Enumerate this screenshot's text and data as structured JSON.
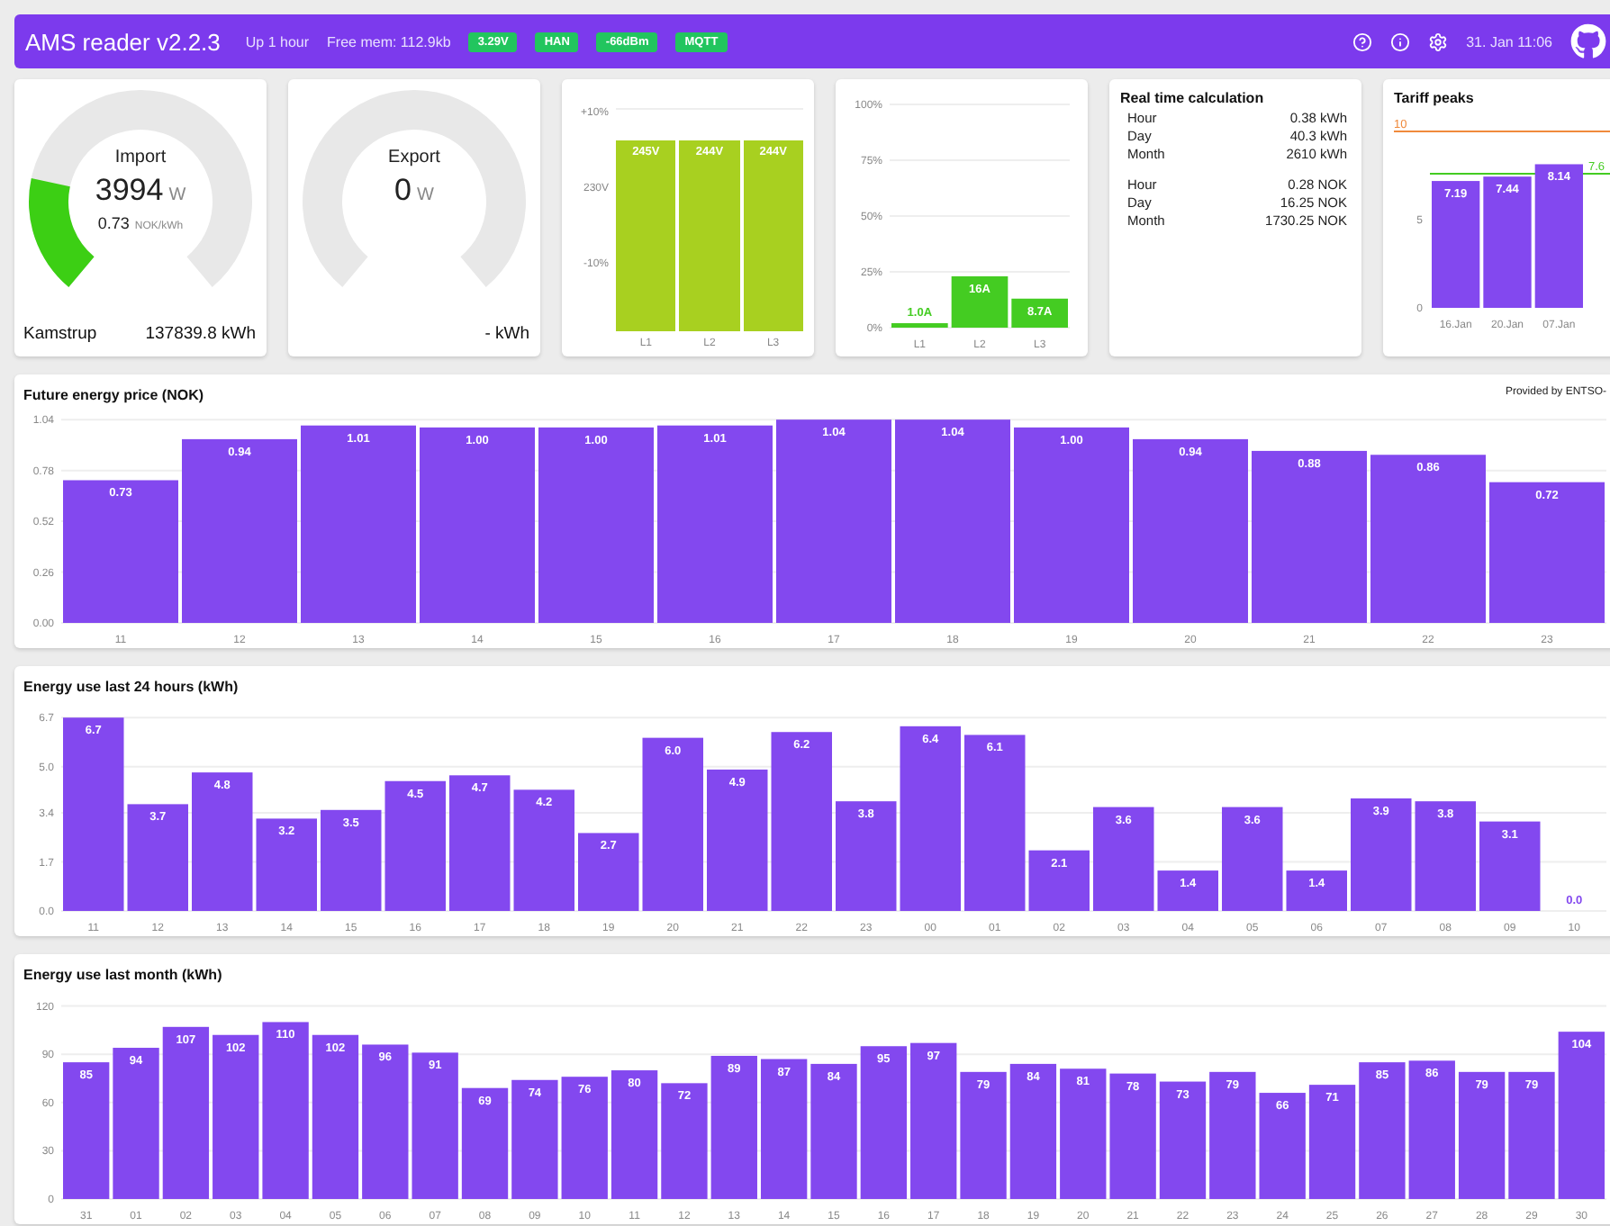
{
  "header": {
    "title": "AMS reader v2.2.3",
    "uptime": "Up 1 hour",
    "memory": "Free mem: 112.9kb",
    "badges": [
      "3.29V",
      "HAN",
      "-66dBm",
      "MQTT"
    ],
    "datetime": "31. Jan 11:06"
  },
  "meters": [
    {
      "label": "Import",
      "value": "3994",
      "unit": "W",
      "price": "0.73",
      "price_unit": "NOK/kWh",
      "meter_name": "Kamstrup",
      "total": "137839.8 kWh"
    },
    {
      "label": "Export",
      "value": "0",
      "unit": "W",
      "total": "- kWh"
    }
  ],
  "voltage": {
    "axis_labels": [
      "+10%",
      "230V",
      "-10%"
    ],
    "bars": [
      {
        "phase": "L1",
        "reading": "245V"
      },
      {
        "phase": "L2",
        "reading": "244V"
      },
      {
        "phase": "L3",
        "reading": "244V"
      }
    ]
  },
  "current": {
    "chart_data": {
      "type": "bar",
      "categories": [
        "L1",
        "L2",
        "L3"
      ],
      "series": [
        {
          "color": "#44cc22",
          "values": [
            2,
            23,
            13
          ]
        }
      ],
      "value_labels": [
        "1.0A",
        "16A",
        "8.7A"
      ],
      "grid": true,
      "ylim": [
        0,
        100
      ],
      "yticks": [
        {
          "value": 0,
          "label": "0%"
        },
        {
          "value": 25,
          "label": "25%"
        },
        {
          "value": 50,
          "label": "50%"
        },
        {
          "value": 75,
          "label": "75%"
        },
        {
          "value": 100,
          "label": "100%"
        }
      ]
    }
  },
  "realtime": {
    "title": "Real time calculation",
    "groups": [
      [
        {
          "label": "Hour",
          "value": "0.38 kWh"
        },
        {
          "label": "Day",
          "value": "40.3 kWh"
        },
        {
          "label": "Month",
          "value": "2610 kWh"
        }
      ],
      [
        {
          "label": "Hour",
          "value": "0.28 NOK"
        },
        {
          "label": "Day",
          "value": "16.25 NOK"
        },
        {
          "label": "Month",
          "value": "1730.25 NOK"
        }
      ]
    ]
  },
  "tariff": {
    "chart_data": {
      "type": "bar",
      "title": "Tariff peaks",
      "categories": [
        "16.Jan",
        "20.Jan",
        "07.Jan"
      ],
      "series": [
        {
          "color": "#8348ef",
          "values": [
            7.19,
            7.44,
            8.14
          ]
        }
      ],
      "value_labels": [
        "7.19",
        "7.44",
        "8.14"
      ],
      "ylim": [
        0,
        10
      ],
      "yticks": [
        0,
        5
      ]
    },
    "thresholds": [
      {
        "label": "10",
        "color": "#f08a3c"
      },
      {
        "label": "7.6",
        "color": "#44cc22"
      }
    ]
  },
  "price": {
    "source": "Provided by ENTSO-",
    "chart_data": {
      "type": "bar",
      "title": "Future energy price (NOK)",
      "categories": [
        "11",
        "12",
        "13",
        "14",
        "15",
        "16",
        "17",
        "18",
        "19",
        "20",
        "21",
        "22",
        "23"
      ],
      "grid": true,
      "series": [
        {
          "color": "#8348ef",
          "values": [
            0.73,
            0.94,
            1.01,
            1.0,
            1.0,
            1.01,
            1.04,
            1.04,
            1.0,
            0.94,
            0.88,
            0.86,
            0.72
          ]
        }
      ],
      "value_labels": [
        "0.73",
        "0.94",
        "1.01",
        "1.00",
        "1.00",
        "1.01",
        "1.04",
        "1.04",
        "1.00",
        "0.94",
        "0.88",
        "0.86",
        "0.72"
      ],
      "ylim": [
        0,
        1.05
      ],
      "yticks": [
        {
          "value": 0,
          "label": "0.00"
        },
        {
          "value": 0.26,
          "label": "0.26"
        },
        {
          "value": 0.52,
          "label": "0.52"
        },
        {
          "value": 0.78,
          "label": "0.78"
        },
        {
          "value": 1.04,
          "label": "1.04"
        }
      ]
    }
  },
  "hourly": {
    "chart_data": {
      "type": "bar",
      "title": "Energy use last 24 hours (kWh)",
      "categories": [
        "11",
        "12",
        "13",
        "14",
        "15",
        "16",
        "17",
        "18",
        "19",
        "20",
        "21",
        "22",
        "23",
        "00",
        "01",
        "02",
        "03",
        "04",
        "05",
        "06",
        "07",
        "08",
        "09",
        "10"
      ],
      "grid": true,
      "series": [
        {
          "color": "#8348ef",
          "values": [
            6.7,
            3.7,
            4.8,
            3.2,
            3.5,
            4.5,
            4.7,
            4.2,
            2.7,
            6.0,
            4.9,
            6.2,
            3.8,
            6.4,
            6.1,
            2.1,
            3.6,
            1.4,
            3.6,
            1.4,
            3.9,
            3.8,
            3.1,
            0.0
          ]
        }
      ],
      "value_labels": [
        "6.7",
        "3.7",
        "4.8",
        "3.2",
        "3.5",
        "4.5",
        "4.7",
        "4.2",
        "2.7",
        "6.0",
        "4.9",
        "6.2",
        "3.8",
        "6.4",
        "6.1",
        "2.1",
        "3.6",
        "1.4",
        "3.6",
        "1.4",
        "3.9",
        "3.8",
        "3.1",
        "0.0"
      ],
      "ylim": [
        0,
        6.8
      ],
      "yticks": [
        {
          "value": 0,
          "label": "0.0"
        },
        {
          "value": 1.7,
          "label": "1.7"
        },
        {
          "value": 3.4,
          "label": "3.4"
        },
        {
          "value": 5.0,
          "label": "5.0"
        },
        {
          "value": 6.7,
          "label": "6.7"
        }
      ]
    }
  },
  "monthly": {
    "chart_data": {
      "type": "bar",
      "title": "Energy use last month (kWh)",
      "categories": [
        "31",
        "01",
        "02",
        "03",
        "04",
        "05",
        "06",
        "07",
        "08",
        "09",
        "10",
        "11",
        "12",
        "13",
        "14",
        "15",
        "16",
        "17",
        "18",
        "19",
        "20",
        "21",
        "22",
        "23",
        "24",
        "25",
        "26",
        "27",
        "28",
        "29",
        "30"
      ],
      "grid": true,
      "series": [
        {
          "color": "#8348ef",
          "values": [
            85,
            94,
            107,
            102,
            110,
            102,
            96,
            91,
            69,
            74,
            76,
            80,
            72,
            89,
            87,
            84,
            95,
            97,
            79,
            84,
            81,
            78,
            73,
            79,
            66,
            71,
            85,
            86,
            79,
            79,
            104
          ]
        }
      ],
      "value_labels": [
        "85",
        "94",
        "107",
        "102",
        "110",
        "102",
        "96",
        "91",
        "69",
        "74",
        "76",
        "80",
        "72",
        "89",
        "87",
        "84",
        "95",
        "97",
        "79",
        "84",
        "81",
        "78",
        "73",
        "79",
        "66",
        "71",
        "85",
        "86",
        "79",
        "79",
        "104"
      ],
      "ylim": [
        0,
        122
      ],
      "yticks": [
        0,
        30,
        60,
        90,
        120
      ]
    }
  }
}
